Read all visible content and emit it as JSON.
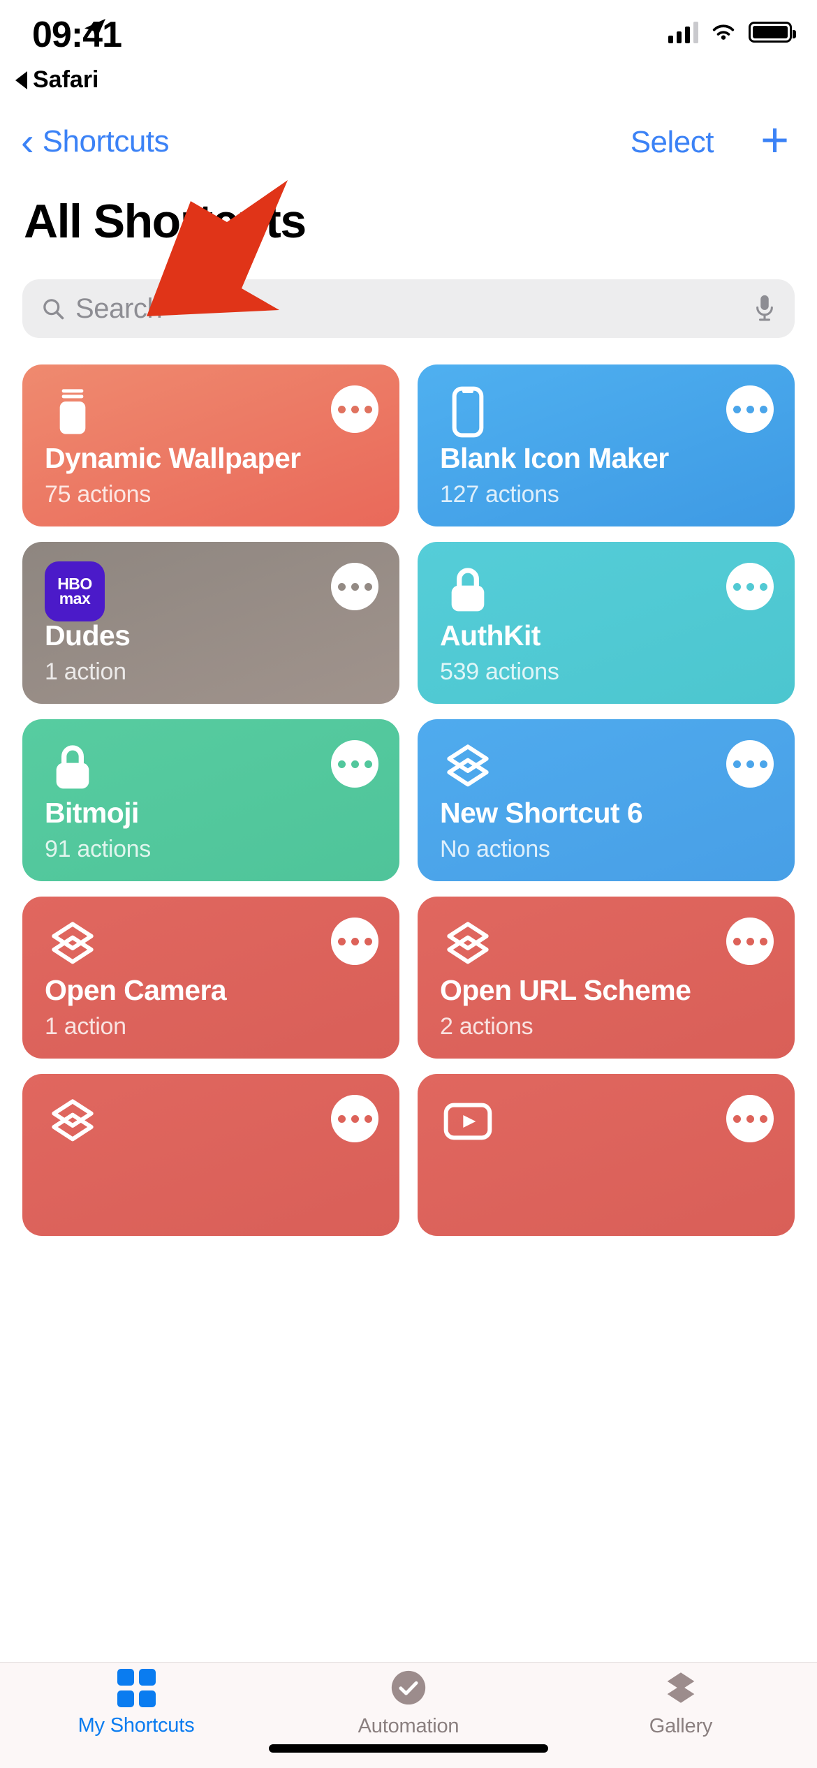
{
  "status_bar": {
    "time": "09:41",
    "location_icon": "location-arrow-icon",
    "back_app_label": "Safari",
    "signal_icon": "cellular-signal-icon",
    "wifi_icon": "wifi-icon",
    "battery_icon": "battery-full-icon"
  },
  "nav_bar": {
    "back_label": "Shortcuts",
    "back_chevron": "chevron-left-icon",
    "select_label": "Select",
    "add_label": "+"
  },
  "page": {
    "title": "All Shortcuts"
  },
  "search": {
    "placeholder": "Search",
    "value": "",
    "magnifier_icon": "search-icon",
    "mic_icon": "microphone-icon"
  },
  "annotation": {
    "arrow_color": "#e03418",
    "arrow_icon": "red-arrow-pointing-down-left"
  },
  "colors": {
    "accent_blue": "#3b82f6",
    "tab_active": "#0a7cf0",
    "tab_inactive": "#8a7f7f"
  },
  "shortcuts": [
    {
      "title": "Dynamic Wallpaper",
      "subtitle": "75 actions",
      "icon": "jar-container-icon",
      "color_top": "#ef8a6f",
      "color_bottom": "#e9695a",
      "dots_color": "#e0725f"
    },
    {
      "title": "Blank Icon Maker",
      "subtitle": "127 actions",
      "icon": "iphone-device-icon",
      "color_top": "#4fb0f0",
      "color_bottom": "#3e9ae4",
      "dots_color": "#4aa5ea"
    },
    {
      "title": "Dudes",
      "subtitle": "1 action",
      "icon": "hbo-max-app-icon",
      "color_top": "#8e8680",
      "color_bottom": "#a0938c",
      "dots_color": "#938a84"
    },
    {
      "title": "AuthKit",
      "subtitle": "539 actions",
      "icon": "lock-icon",
      "color_top": "#55cdd8",
      "color_bottom": "#4cc6cf",
      "dots_color": "#52c9d3"
    },
    {
      "title": "Bitmoji",
      "subtitle": "91 actions",
      "icon": "lock-icon",
      "color_top": "#57ccA0",
      "color_bottom": "#4fc49a",
      "dots_color": "#52c79c"
    },
    {
      "title": "New Shortcut 6",
      "subtitle": "No actions",
      "icon": "shortcuts-glyph-icon",
      "color_top": "#4fabee",
      "color_bottom": "#489fe6",
      "dots_color": "#4ba5ea"
    },
    {
      "title": "Open Camera",
      "subtitle": "1 action",
      "icon": "shortcuts-glyph-icon",
      "color_top": "#e0675f",
      "color_bottom": "#d95f58",
      "dots_color": "#dd6259"
    },
    {
      "title": "Open URL Scheme",
      "subtitle": "2 actions",
      "icon": "shortcuts-glyph-icon",
      "color_top": "#e0675f",
      "color_bottom": "#d95f58",
      "dots_color": "#dd6259"
    },
    {
      "title": "",
      "subtitle": "",
      "icon": "shortcuts-glyph-icon",
      "color_top": "#e0675f",
      "color_bottom": "#d95f58",
      "dots_color": "#dd6259"
    },
    {
      "title": "",
      "subtitle": "",
      "icon": "play-video-icon",
      "color_top": "#e0675f",
      "color_bottom": "#d95f58",
      "dots_color": "#dd6259"
    }
  ],
  "tab_bar": {
    "items": [
      {
        "label": "My Shortcuts",
        "icon": "grid-squares-icon",
        "active": true
      },
      {
        "label": "Automation",
        "icon": "checkmark-circle-icon",
        "active": false
      },
      {
        "label": "Gallery",
        "icon": "stacked-layers-icon",
        "active": false
      }
    ]
  }
}
